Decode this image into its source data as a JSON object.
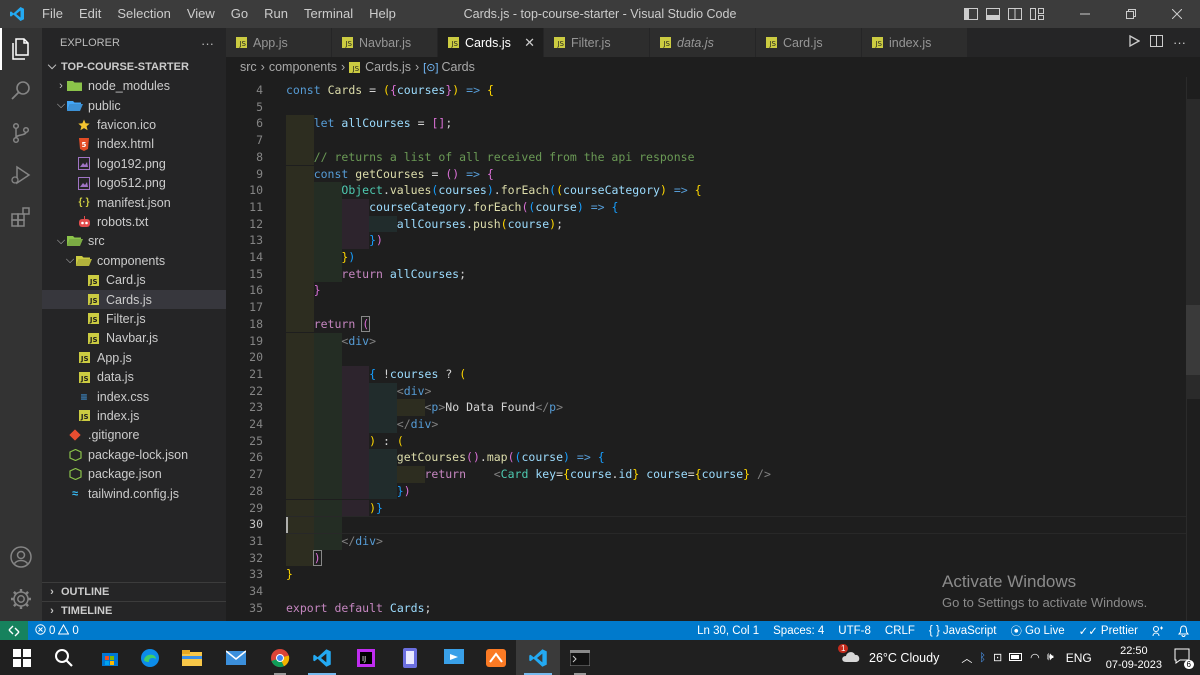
{
  "titlebar": {
    "menu": [
      "File",
      "Edit",
      "Selection",
      "View",
      "Go",
      "Run",
      "Terminal",
      "Help"
    ],
    "title": "Cards.js - top-course-starter - Visual Studio Code"
  },
  "sidebar": {
    "header": "EXPLORER",
    "more": "···",
    "root": "TOP-COURSE-STARTER",
    "items": [
      {
        "label": "node_modules",
        "depth": 1,
        "type": "folder",
        "open": false
      },
      {
        "label": "public",
        "depth": 1,
        "type": "folder",
        "open": true
      },
      {
        "label": "favicon.ico",
        "depth": 2,
        "type": "favicon"
      },
      {
        "label": "index.html",
        "depth": 2,
        "type": "html"
      },
      {
        "label": "logo192.png",
        "depth": 2,
        "type": "image"
      },
      {
        "label": "logo512.png",
        "depth": 2,
        "type": "image"
      },
      {
        "label": "manifest.json",
        "depth": 2,
        "type": "json"
      },
      {
        "label": "robots.txt",
        "depth": 2,
        "type": "robot"
      },
      {
        "label": "src",
        "depth": 1,
        "type": "folder",
        "open": true
      },
      {
        "label": "components",
        "depth": 2,
        "type": "folder",
        "open": true
      },
      {
        "label": "Card.js",
        "depth": 3,
        "type": "js"
      },
      {
        "label": "Cards.js",
        "depth": 3,
        "type": "js",
        "selected": true
      },
      {
        "label": "Filter.js",
        "depth": 3,
        "type": "js"
      },
      {
        "label": "Navbar.js",
        "depth": 3,
        "type": "js"
      },
      {
        "label": "App.js",
        "depth": 2,
        "type": "js"
      },
      {
        "label": "data.js",
        "depth": 2,
        "type": "js"
      },
      {
        "label": "index.css",
        "depth": 2,
        "type": "css"
      },
      {
        "label": "index.js",
        "depth": 2,
        "type": "js"
      },
      {
        "label": ".gitignore",
        "depth": 1,
        "type": "git"
      },
      {
        "label": "package-lock.json",
        "depth": 1,
        "type": "npm"
      },
      {
        "label": "package.json",
        "depth": 1,
        "type": "npm"
      },
      {
        "label": "tailwind.config.js",
        "depth": 1,
        "type": "tailwind"
      }
    ],
    "outline": "OUTLINE",
    "timeline": "TIMELINE"
  },
  "tabs": [
    {
      "label": "App.js",
      "active": false,
      "italic": false
    },
    {
      "label": "Navbar.js",
      "active": false,
      "italic": false
    },
    {
      "label": "Cards.js",
      "active": true,
      "italic": false
    },
    {
      "label": "Filter.js",
      "active": false,
      "italic": false
    },
    {
      "label": "data.js",
      "active": false,
      "italic": true
    },
    {
      "label": "Card.js",
      "active": false,
      "italic": false
    },
    {
      "label": "index.js",
      "active": false,
      "italic": false
    }
  ],
  "breadcrumb": [
    "src",
    "components",
    "Cards.js",
    "Cards"
  ],
  "editor": {
    "lines": [
      {
        "n": 4,
        "html": "<span class='k'>const</span> <span class='f'>Cards</span> <span class='p'>=</span> <span class='b1'>(</span><span class='b2'>{</span><span class='v'>courses</span><span class='b2'>}</span><span class='b1'>)</span> <span class='k'>=&gt;</span> <span class='b1'>{</span>"
      },
      {
        "n": 5,
        "html": ""
      },
      {
        "n": 6,
        "html": "    <span class='k'>let</span> <span class='v'>allCourses</span> <span class='p'>=</span> <span class='b2'>[]</span><span class='p'>;</span>"
      },
      {
        "n": 7,
        "html": ""
      },
      {
        "n": 8,
        "html": "    <span class='c'>// returns a list of all received from the api response</span>"
      },
      {
        "n": 9,
        "html": "    <span class='k'>const</span> <span class='f'>getCourses</span> <span class='p'>=</span> <span class='b2'>()</span> <span class='k'>=&gt;</span> <span class='b2'>{</span>"
      },
      {
        "n": 10,
        "html": "        <span class='t'>Object</span><span class='p'>.</span><span class='f'>values</span><span class='b3'>(</span><span class='v'>courses</span><span class='b3'>)</span><span class='p'>.</span><span class='f'>forEach</span><span class='b3'>(</span><span class='b1'>(</span><span class='v'>courseCategory</span><span class='b1'>)</span> <span class='k'>=&gt;</span> <span class='b1'>{</span>"
      },
      {
        "n": 11,
        "html": "            <span class='v'>courseCategory</span><span class='p'>.</span><span class='f'>forEach</span><span class='b2'>(</span><span class='b3'>(</span><span class='v'>course</span><span class='b3'>)</span> <span class='k'>=&gt;</span> <span class='b3'>{</span>"
      },
      {
        "n": 12,
        "html": "                <span class='v'>allCourses</span><span class='p'>.</span><span class='f'>push</span><span class='b1'>(</span><span class='v'>course</span><span class='b1'>)</span><span class='p'>;</span>"
      },
      {
        "n": 13,
        "html": "            <span class='b3'>}</span><span class='b2'>)</span>"
      },
      {
        "n": 14,
        "html": "        <span class='b1'>}</span><span class='b3'>)</span>"
      },
      {
        "n": 15,
        "html": "        <span class='kc'>return</span> <span class='v'>allCourses</span><span class='p'>;</span>"
      },
      {
        "n": 16,
        "html": "    <span class='b2'>}</span>"
      },
      {
        "n": 17,
        "html": ""
      },
      {
        "n": 18,
        "html": "    <span class='kc'>return</span> <span class='b2' style='outline:1px solid #888'>(</span>"
      },
      {
        "n": 19,
        "html": "        <span class='tg'>&lt;</span><span class='tn'>div</span><span class='tg'>&gt;</span>"
      },
      {
        "n": 20,
        "html": ""
      },
      {
        "n": 21,
        "html": "            <span class='b3'>{</span> <span class='p'>!</span><span class='v'>courses</span> <span class='p'>?</span> <span class='b1'>(</span>"
      },
      {
        "n": 22,
        "html": "                <span class='tg'>&lt;</span><span class='tn'>div</span><span class='tg'>&gt;</span>"
      },
      {
        "n": 23,
        "html": "                    <span class='tg'>&lt;</span><span class='tn'>p</span><span class='tg'>&gt;</span><span class='p'>No Data Found</span><span class='tg'>&lt;/</span><span class='tn'>p</span><span class='tg'>&gt;</span>"
      },
      {
        "n": 24,
        "html": "                <span class='tg'>&lt;/</span><span class='tn'>div</span><span class='tg'>&gt;</span>"
      },
      {
        "n": 25,
        "html": "            <span class='b1'>)</span> <span class='p'>:</span> <span class='b1'>(</span>"
      },
      {
        "n": 26,
        "html": "                <span class='f'>getCourses</span><span class='b2'>()</span><span class='p'>.</span><span class='f'>map</span><span class='b2'>(</span><span class='b3'>(</span><span class='v'>course</span><span class='b3'>)</span> <span class='k'>=&gt;</span> <span class='b3'>{</span>"
      },
      {
        "n": 27,
        "html": "                    <span class='kc'>return</span>    <span class='tg'>&lt;</span><span class='t'>Card</span> <span class='v'>key</span><span class='p'>=</span><span class='b1'>{</span><span class='v'>course</span><span class='p'>.</span><span class='v'>id</span><span class='b1'>}</span> <span class='v'>course</span><span class='p'>=</span><span class='b1'>{</span><span class='v'>course</span><span class='b1'>}</span> <span class='tg'>/&gt;</span>"
      },
      {
        "n": 28,
        "html": "                <span class='b3'>}</span><span class='b2'>)</span>"
      },
      {
        "n": 29,
        "html": "            <span class='b1'>)</span><span class='b3'>}</span>"
      },
      {
        "n": 30,
        "html": ""
      },
      {
        "n": 31,
        "html": "        <span class='tg'>&lt;/</span><span class='tn'>div</span><span class='tg'>&gt;</span>"
      },
      {
        "n": 32,
        "html": "    <span class='b2' style='outline:1px solid #888'>)</span>"
      },
      {
        "n": 33,
        "html": "<span class='b1'>}</span>"
      },
      {
        "n": 34,
        "html": ""
      },
      {
        "n": 35,
        "html": "<span class='kc'>export</span> <span class='kc'>default</span> <span class='v'>Cards</span><span class='p'>;</span>"
      }
    ],
    "current_line": 30
  },
  "watermark": {
    "title": "Activate Windows",
    "subtitle": "Go to Settings to activate Windows."
  },
  "status": {
    "errors": "0",
    "warnings": "0",
    "position": "Ln 30, Col 1",
    "spaces": "Spaces: 4",
    "encoding": "UTF-8",
    "eol": "CRLF",
    "language": "JavaScript",
    "golive": "Go Live",
    "prettier": "Prettier"
  },
  "taskbar": {
    "weather": "26°C  Cloudy",
    "language": "ENG",
    "time": "22:50",
    "date": "07-09-2023",
    "notifications": "6",
    "weather_badge": "1"
  },
  "colors": {
    "accent": "#007acc",
    "js": "#cbcb41",
    "folder": "#dcb67a"
  }
}
